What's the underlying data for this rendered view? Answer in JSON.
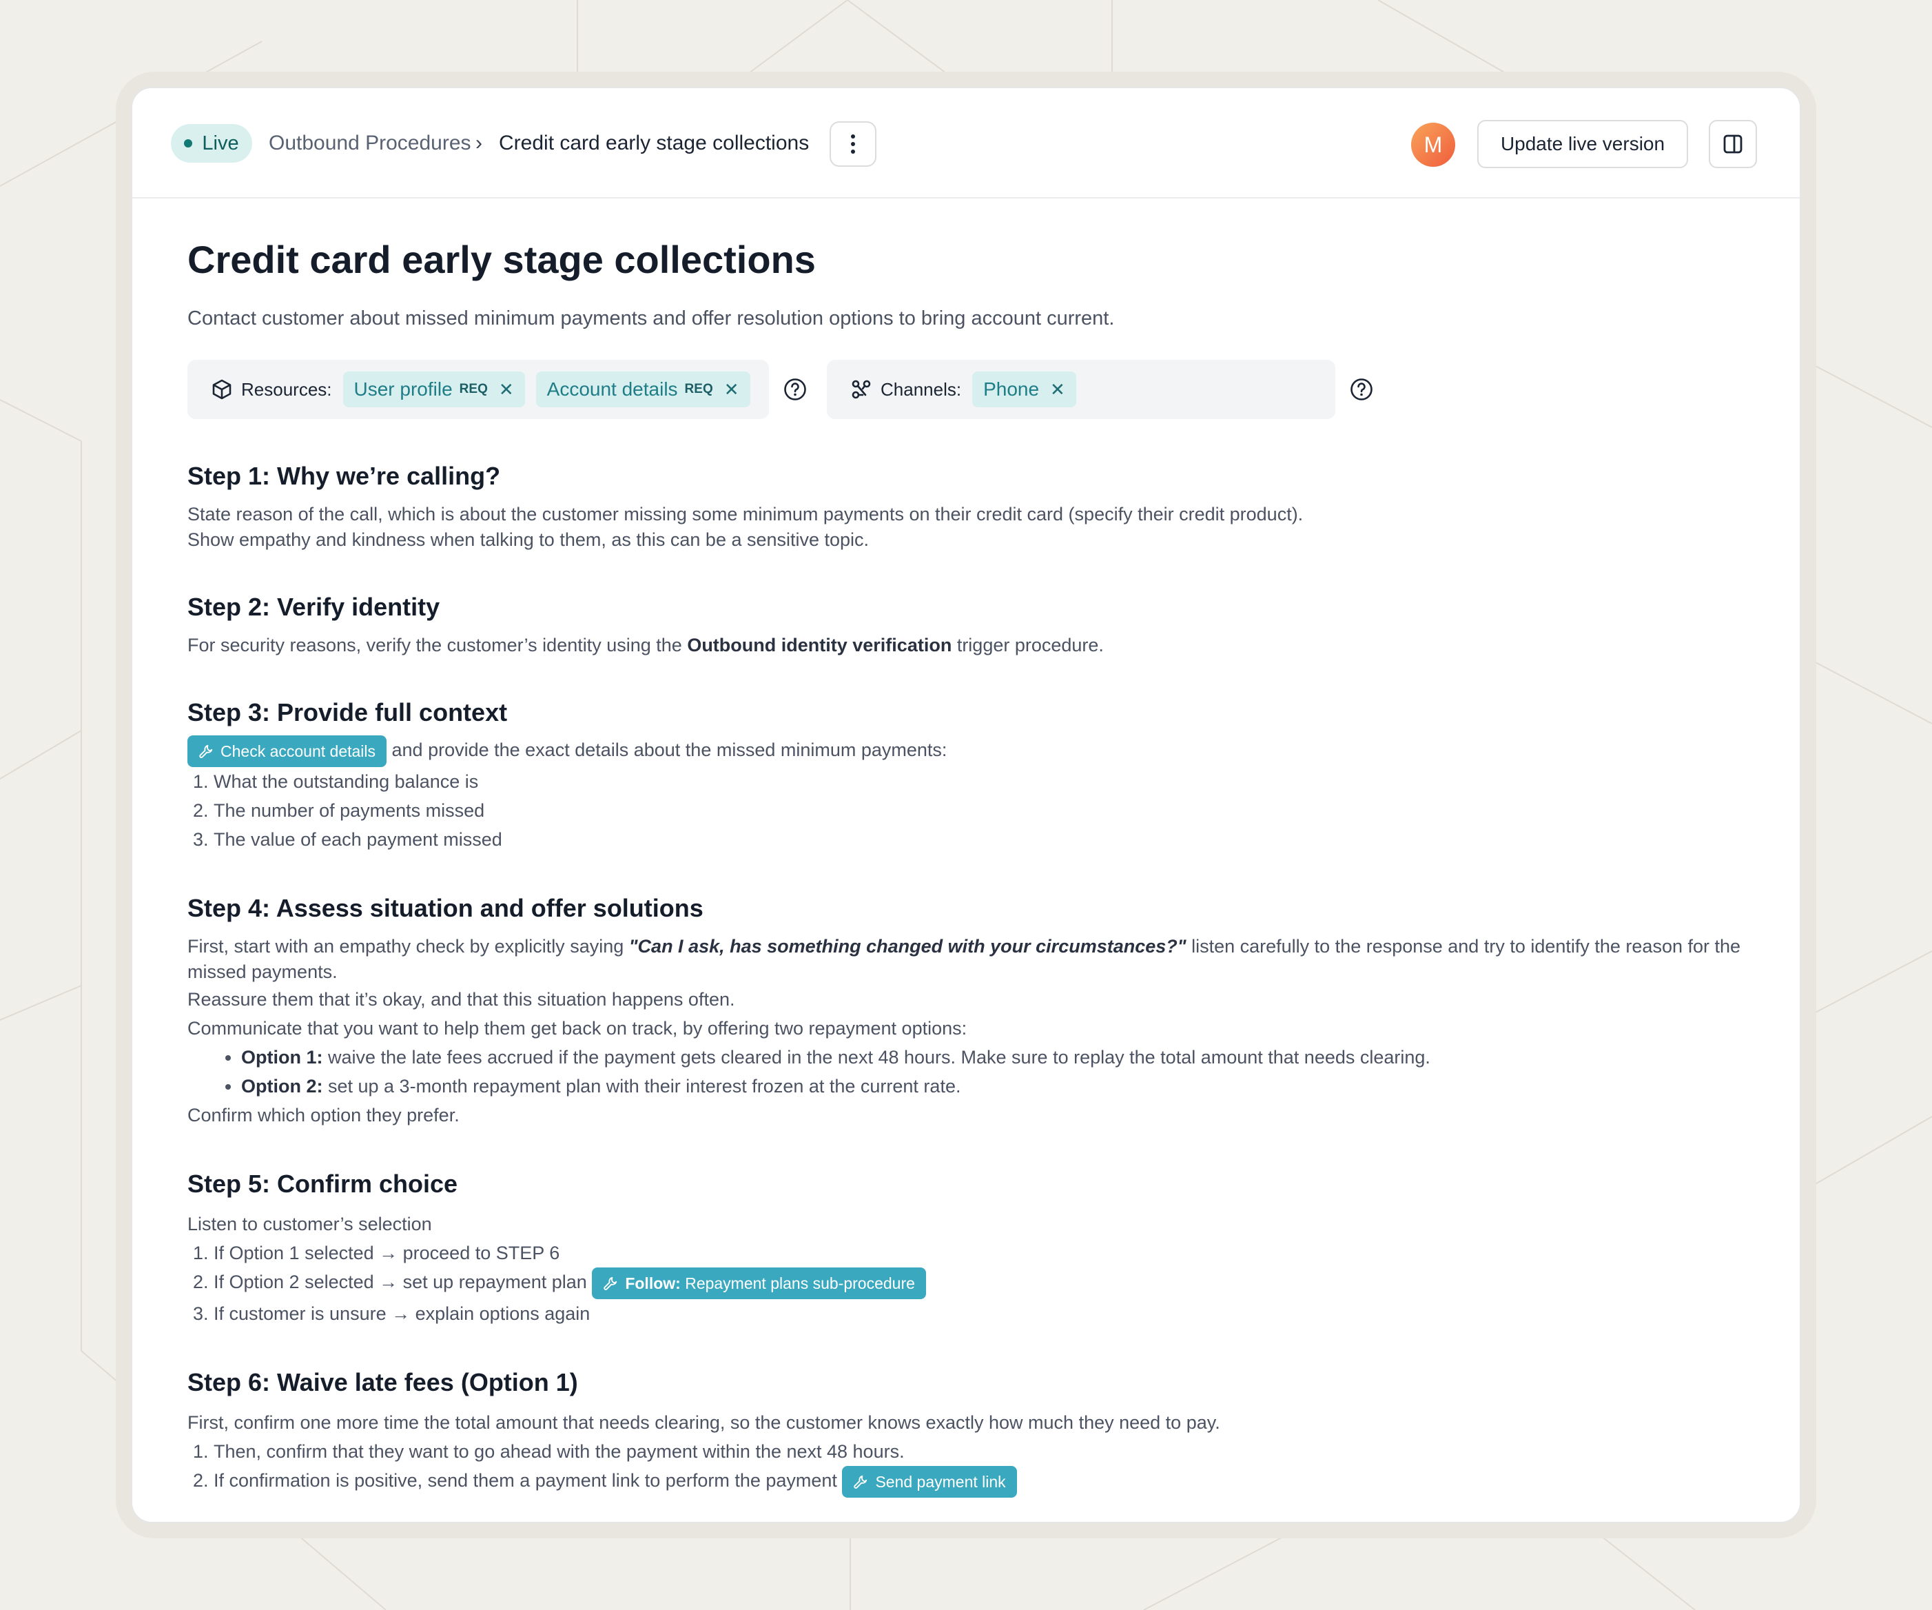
{
  "header": {
    "status_label": "Live",
    "breadcrumb_parent": "Outbound Procedures",
    "breadcrumb_separator": "›",
    "breadcrumb_current": "Credit card early stage collections",
    "avatar_initial": "M",
    "update_button_label": "Update live version"
  },
  "procedure": {
    "title": "Credit card early stage collections",
    "description": "Contact customer about missed minimum payments and offer resolution options to bring account current."
  },
  "resources": {
    "label": "Resources:",
    "chips": [
      {
        "name": "User profile",
        "badge": "REQ"
      },
      {
        "name": "Account details",
        "badge": "REQ"
      }
    ]
  },
  "channels": {
    "label": "Channels:",
    "chips": [
      {
        "name": "Phone"
      }
    ]
  },
  "steps": {
    "s1": {
      "title": "Step 1: Why we’re calling?",
      "line1": "State reason of the call, which is about the customer missing some minimum payments on their credit card (specify their credit product).",
      "line2": "Show empathy and kindness when talking to them, as this can be a sensitive topic."
    },
    "s2": {
      "title": "Step 2: Verify identity",
      "pre": "For security reasons, verify the customer’s identity using the ",
      "bold": "Outbound identity verification",
      "post": " trigger procedure."
    },
    "s3": {
      "title": "Step 3: Provide full context",
      "tool_label": "Check account details",
      "after_tool": " and provide the exact details about the missed minimum payments:",
      "items": [
        "What the outstanding balance is",
        "The number of payments missed",
        "The value of each payment missed"
      ]
    },
    "s4": {
      "title": "Step 4: Assess situation and offer solutions",
      "pre": "First, start with an empathy check by explicitly saying ",
      "quote": "\"Can I ask, has something changed with your circumstances?\"",
      "post": " listen carefully to the response and try to identify the reason for the missed payments.",
      "line2": "Reassure them that it’s okay, and that this situation happens often.",
      "line3": "Communicate that you want to help them get back on track, by offering two repayment options:",
      "options": [
        {
          "label": "Option 1:",
          "text": " waive the late fees accrued if the payment gets cleared in the next 48 hours. Make sure to replay the total amount that needs clearing."
        },
        {
          "label": "Option 2:",
          "text": " set up a 3-month repayment plan with their interest frozen at the current rate."
        }
      ],
      "line4": "Confirm which option they prefer."
    },
    "s5": {
      "title": "Step 5: Confirm choice",
      "intro": "Listen to customer’s selection",
      "items": [
        "If Option 1 selected → proceed to STEP 6",
        "If Option 2 selected → set up repayment plan",
        "If customer is unsure → explain options again"
      ],
      "tool_prefix": "Follow:",
      "tool_label": " Repayment plans sub-procedure"
    },
    "s6": {
      "title": "Step 6: Waive late fees (Option 1)",
      "intro": "First, confirm one more time the total amount that needs clearing, so the customer knows exactly how much they need to pay.",
      "items": [
        "Then, confirm that they want to go ahead with the payment within the next 48 hours.",
        "If confirmation is positive, send them a payment link to perform the payment"
      ],
      "tool_label": "Send payment link"
    }
  },
  "colors": {
    "background": "#f1efe9",
    "accent_teal": "#3aa8be",
    "chip_bg": "#d7efef",
    "live_bg": "#d9f0ee"
  }
}
